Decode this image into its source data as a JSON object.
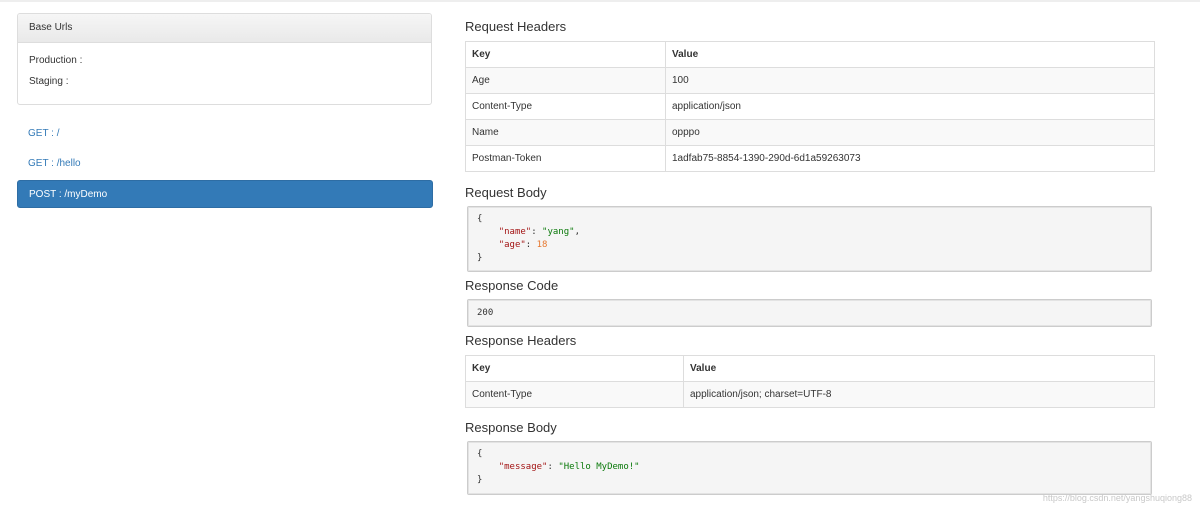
{
  "base_urls": {
    "title": "Base Urls",
    "production_label": "Production :",
    "staging_label": "Staging :"
  },
  "endpoints": [
    {
      "label": "GET : /",
      "active": false
    },
    {
      "label": "GET : /hello",
      "active": false
    },
    {
      "label": "POST : /myDemo",
      "active": true
    }
  ],
  "request_headers": {
    "title": "Request Headers",
    "columns": [
      "Key",
      "Value"
    ],
    "rows": [
      {
        "key": "Age",
        "value": "100"
      },
      {
        "key": "Content-Type",
        "value": "application/json"
      },
      {
        "key": "Name",
        "value": "opppo"
      },
      {
        "key": "Postman-Token",
        "value": "1adfab75-8854-1390-290d-6d1a59263073"
      }
    ]
  },
  "request_body": {
    "title": "Request Body",
    "open": "{",
    "fields": [
      {
        "key": "\"name\"",
        "sep": ": ",
        "value": "\"yang\"",
        "value_type": "str",
        "trail": ","
      },
      {
        "key": "\"age\"",
        "sep": ": ",
        "value": "18",
        "value_type": "num",
        "trail": ""
      }
    ],
    "close": "}"
  },
  "response_code": {
    "title": "Response Code",
    "value": "200"
  },
  "response_headers": {
    "title": "Response Headers",
    "columns": [
      "Key",
      "Value"
    ],
    "rows": [
      {
        "key": "Content-Type",
        "value": "application/json; charset=UTF-8"
      }
    ]
  },
  "response_body": {
    "title": "Response Body",
    "open": "{",
    "fields": [
      {
        "key": "\"message\"",
        "sep": ": ",
        "value": "\"Hello MyDemo!\"",
        "value_type": "str",
        "trail": ""
      }
    ],
    "close": "}"
  },
  "watermark": "https://blog.csdn.net/yangshuqiong88",
  "colors": {
    "accent": "#337ab7",
    "json_key": "#a31515",
    "json_string": "#0b7a0b",
    "json_number": "#e6772e"
  }
}
